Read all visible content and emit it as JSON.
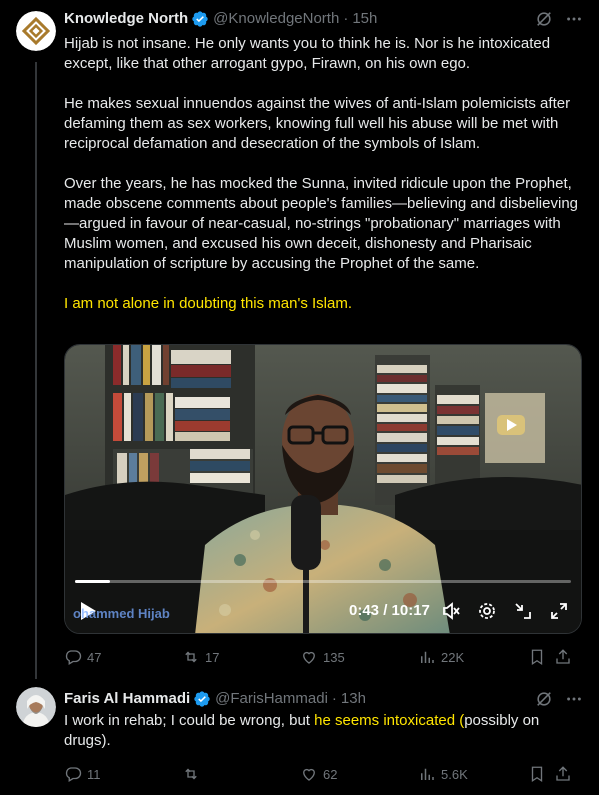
{
  "tweet1": {
    "name": "Knowledge North",
    "handle": "@KnowledgeNorth",
    "separator": "·",
    "time": "15h",
    "paragraphs": [
      "Hijab is not insane. He only wants you to think he is. Nor is he intoxicated except, like that other arrogant gypo, Firawn, on his own ego.",
      "He makes sexual innuendos against the wives of anti-Islam polemicists after defaming them as sex workers, knowing full well his abuse will be met with reciprocal defamation and desecration of the symbols of Islam.",
      "Over the years, he has mocked the Sunna, invited ridicule upon the Prophet, made obscene comments about people's families—believing and disbelieving—argued in favour of near-casual, no-strings \"probationary\" marriages with Muslim women, and excused his own deceit, dishonesty and Pharisaic manipulation of scripture by accusing the Prophet of the same."
    ],
    "highlight_line": "I am not alone in doubting this man's Islam.",
    "video": {
      "watermark": "ohammed Hijab",
      "timecode": "0:43 / 10:17",
      "progress": 0.07
    },
    "stats": {
      "replies": "47",
      "reposts": "17",
      "likes": "135",
      "views": "22K"
    }
  },
  "tweet2": {
    "name": "Faris Al Hammadi",
    "handle": "@FarisHammadi",
    "separator": "·",
    "time": "13h",
    "text_before": "I work in rehab; I could be wrong, but ",
    "text_highlight": "he seems intoxicated (",
    "text_after": "possibly on drugs).",
    "stats": {
      "replies": "11",
      "reposts": "",
      "likes": "62",
      "views": "5.6K"
    }
  },
  "colors": {
    "background": "#000000",
    "text": "#e7e9ea",
    "muted": "#71767b",
    "verified": "#1d9bf0",
    "highlight": "#ffe500"
  },
  "icons": [
    "verified-badge-icon",
    "grok-icon",
    "more-icon",
    "play-icon",
    "mute-icon",
    "settings-icon",
    "minimize-icon",
    "fullscreen-icon",
    "reply-icon",
    "repost-icon",
    "like-icon",
    "views-icon",
    "bookmark-icon",
    "share-icon"
  ]
}
